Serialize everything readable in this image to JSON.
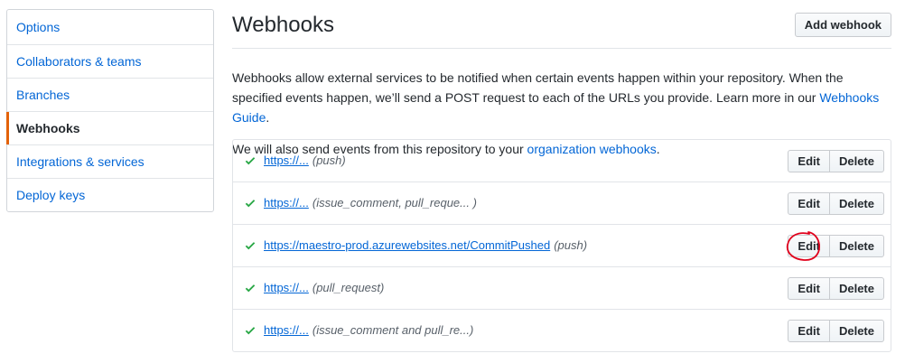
{
  "sidebar": {
    "items": [
      {
        "label": "Options",
        "active": false
      },
      {
        "label": "Collaborators & teams",
        "active": false
      },
      {
        "label": "Branches",
        "active": false
      },
      {
        "label": "Webhooks",
        "active": true
      },
      {
        "label": "Integrations & services",
        "active": false
      },
      {
        "label": "Deploy keys",
        "active": false
      }
    ]
  },
  "header": {
    "title": "Webhooks",
    "add_button_label": "Add webhook"
  },
  "description": {
    "text_before_link": "Webhooks allow external services to be notified when certain events happen within your repository. When the specified events happen, we’ll send a POST request to each of the URLs you provide. Learn more in our ",
    "link_text": "Webhooks Guide",
    "text_after_link": "."
  },
  "org_notice": {
    "text_before_link": "We will also send events from this repository to your ",
    "link_text": "organization webhooks",
    "text_after_link": "."
  },
  "hooks": [
    {
      "url": "https://...",
      "events": "(push)",
      "edit_label": "Edit",
      "delete_label": "Delete",
      "status": "success"
    },
    {
      "url": "https://...",
      "events": "(issue_comment, pull_reque... )",
      "edit_label": "Edit",
      "delete_label": "Delete",
      "status": "success"
    },
    {
      "url": "https://maestro-prod.azurewebsites.net/CommitPushed",
      "events": "(push)",
      "edit_label": "Edit",
      "delete_label": "Delete",
      "status": "success"
    },
    {
      "url": "https://...",
      "events": "(pull_request)",
      "edit_label": "Edit",
      "delete_label": "Delete",
      "status": "success"
    },
    {
      "url": "https://...",
      "events": "(issue_comment and pull_re...)",
      "edit_label": "Edit",
      "delete_label": "Delete",
      "status": "success"
    }
  ],
  "icons": {
    "check": "check-icon",
    "annotation": "red-circle-annotation"
  },
  "colors": {
    "link": "#0366d6",
    "active_indicator": "#e36209",
    "check": "#28a745",
    "annotation": "#e0001b"
  }
}
